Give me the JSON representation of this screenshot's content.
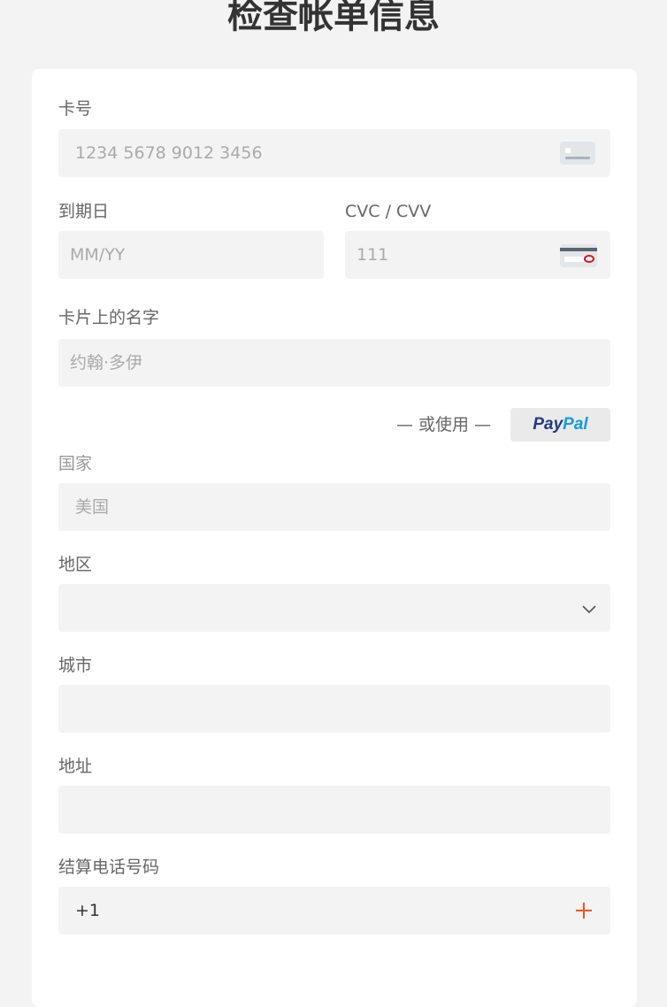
{
  "page": {
    "title": "检查帐单信息"
  },
  "form": {
    "card_number": {
      "label": "卡号",
      "placeholder": "1234 5678 9012 3456",
      "icon": "credit-card-icon"
    },
    "expiry": {
      "label": "到期日",
      "placeholder": "MM/YY"
    },
    "cvc": {
      "label": "CVC / CVV",
      "placeholder": "111",
      "icon": "card-back-cvc-icon"
    },
    "name_on_card": {
      "label": "卡片上的名字",
      "placeholder": "约翰·多伊"
    },
    "alternative": {
      "or_text": "— 或使用 —",
      "paypal_pay": "Pay",
      "paypal_pal": "Pal"
    },
    "country": {
      "label": "国家",
      "value": "美国"
    },
    "region": {
      "label": "地区",
      "value": "",
      "icon": "chevron-down-icon"
    },
    "city": {
      "label": "城市",
      "value": ""
    },
    "address": {
      "label": "地址",
      "value": ""
    },
    "phone": {
      "label": "结算电话号码",
      "country_code": "+1",
      "icon": "plus-icon"
    }
  },
  "colors": {
    "background": "#f3f3f3",
    "card": "#ffffff",
    "field": "#f3f3f3",
    "accent": "#e8581c",
    "paypal_dark": "#253b80",
    "paypal_light": "#179bd7"
  }
}
